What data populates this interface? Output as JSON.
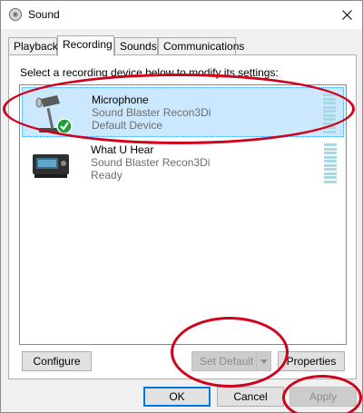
{
  "window": {
    "title": "Sound"
  },
  "tabs": [
    {
      "label": "Playback",
      "active": false
    },
    {
      "label": "Recording",
      "active": true
    },
    {
      "label": "Sounds",
      "active": false
    },
    {
      "label": "Communications",
      "active": false
    }
  ],
  "panel": {
    "instructions": "Select a recording device below to modify its settings:"
  },
  "devices": [
    {
      "name": "Microphone",
      "driver": "Sound Blaster Recon3Di",
      "status": "Default Device",
      "selected": true,
      "icon": "microphone-default-icon"
    },
    {
      "name": "What U Hear",
      "driver": "Sound Blaster Recon3Di",
      "status": "Ready",
      "selected": false,
      "icon": "sound-card-icon"
    }
  ],
  "buttons": {
    "configure": "Configure",
    "set_default": "Set Default",
    "properties": "Properties",
    "ok": "OK",
    "cancel": "Cancel",
    "apply": "Apply"
  },
  "colors": {
    "selection": "#cce8ff",
    "annotation": "#d0021b",
    "level_meter": "#a9d9e7"
  }
}
